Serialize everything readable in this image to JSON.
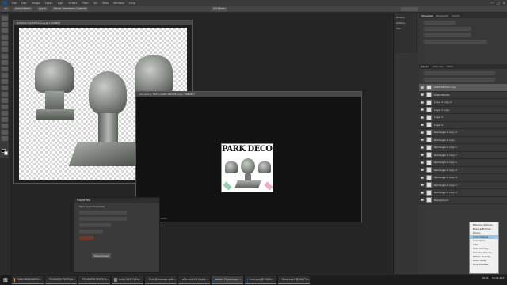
{
  "menubar": {
    "items": [
      "File",
      "Edit",
      "Image",
      "Layer",
      "Type",
      "Select",
      "Filter",
      "3D",
      "View",
      "Window",
      "Help"
    ],
    "controls": [
      "—",
      "□",
      "✕"
    ]
  },
  "optionsbar": {
    "items": [
      "Auto-Select:",
      "Layer",
      "Show Transform Controls"
    ],
    "mode_label": "3D Mode:"
  },
  "doc1": {
    "title": "Untitled-1 @ 33.3% (Layer 1, RGB/8)"
  },
  "doc2": {
    "title": "Icon.psd @ 100% (PARK DECOR copy, RGB/8#)",
    "zoom": "100%"
  },
  "artwork": {
    "title": "PARK DECOR"
  },
  "properties": {
    "title": "Properties",
    "subtitle": "Type Layer Properties",
    "button": "Reset Image"
  },
  "right": {
    "history_tabs": [
      "History",
      "Actions",
      "Info"
    ],
    "char_tabs": [
      "Character",
      "Paragraph",
      "Glyphs"
    ],
    "layers_tabs": [
      "Layers",
      "Channels",
      "Paths"
    ],
    "layers": [
      {
        "name": "PARK DECOR copy",
        "sel": true
      },
      {
        "name": "PARK DECOR",
        "sel": false
      },
      {
        "name": "Layer 1 copy 2",
        "sel": false
      },
      {
        "name": "Layer 1 copy",
        "sel": false
      },
      {
        "name": "Layer 1",
        "sel": false
      },
      {
        "name": "Layer 2",
        "sel": false
      },
      {
        "name": "Rectangle 1 copy 3",
        "sel": false
      },
      {
        "name": "Rectangle 1 copy",
        "sel": false
      },
      {
        "name": "Rectangle 1 copy 5",
        "sel": false
      },
      {
        "name": "Rectangle 1 copy 7",
        "sel": false
      },
      {
        "name": "Rectangle 1 copy 6",
        "sel": false
      },
      {
        "name": "Rectangle 1 copy 8",
        "sel": false
      },
      {
        "name": "Rectangle 1 copy 4",
        "sel": false
      },
      {
        "name": "Rectangle 1 copy 2",
        "sel": false
      },
      {
        "name": "Rectangle 1 copy 9",
        "sel": false
      },
      {
        "name": "Background",
        "sel": false
      }
    ]
  },
  "context_menu": {
    "items": [
      "Blending Options...",
      "Bevel & Emboss...",
      "Stroke...",
      "Inner Shadow...",
      "Inner Glow...",
      "Satin...",
      "Color Overlay...",
      "Gradient Overlay...",
      "Pattern Overlay...",
      "Outer Glow...",
      "Drop Shadow..."
    ],
    "highlight_index": 3
  },
  "taskbar": {
    "items": [
      "PARK DECORATIO...",
      "TOURISTS TEXTS 6...",
      "TOURISTS TEXTS 6...",
      "Unity 2017.1 Pe...",
      "Park Decorado with...",
      "uTorrent 3.5 (build...",
      "Adobe Photoshop ...",
      "Icon.psd @ 100%...",
      "Sketches.t @ 66.7%..."
    ],
    "active_index": 6,
    "clock": "16:21",
    "date": "28.09.2017"
  }
}
